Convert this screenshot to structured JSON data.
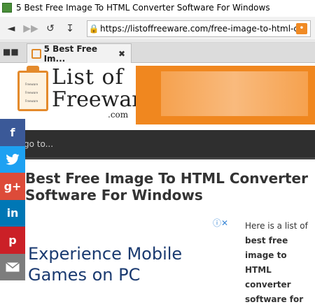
{
  "window": {
    "title": "5 Best Free Image To HTML Converter Software For Windows"
  },
  "toolbar": {
    "url": "https://listoffreeware.com/free-image-to-html-cor"
  },
  "tab": {
    "label": "5 Best Free Im..."
  },
  "logo": {
    "line1": "List of",
    "line2": "Freeware",
    "line3": ".com",
    "clipboard_lines": [
      "Freeware",
      "Freeware",
      "Freeware"
    ]
  },
  "menubar": {
    "text": "go to..."
  },
  "social": {
    "buttons": [
      "f",
      "t",
      "g+",
      "in",
      "p",
      "mail"
    ]
  },
  "article": {
    "title": "Best Free Image To HTML Converter Software For Windows"
  },
  "ad": {
    "title": "Experience Mobile Games on PC"
  },
  "sidebar": {
    "intro": "Here is a list of",
    "bold": "best free image to HTML converter software for"
  },
  "colors": {
    "brand_orange": "#f0871f",
    "facebook": "#3b5998",
    "twitter": "#1da1f2",
    "googleplus": "#dd4b39",
    "linkedin": "#0077b5",
    "pinterest": "#cb2027",
    "email": "#7d7d7d"
  }
}
